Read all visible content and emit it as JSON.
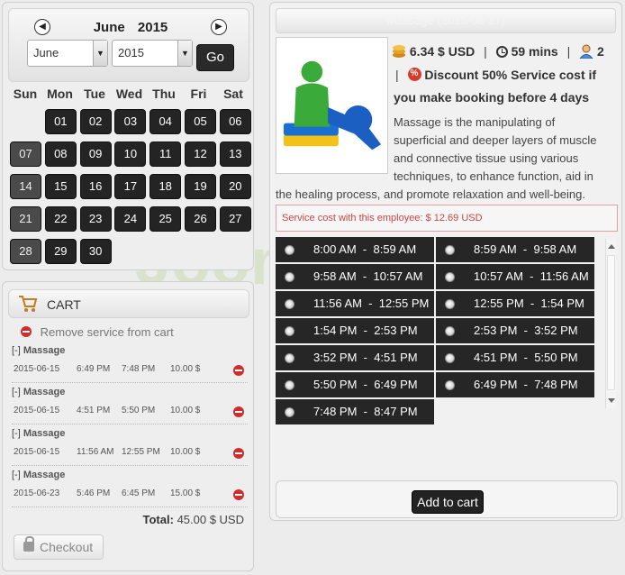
{
  "calendar": {
    "prev_icon": "chevron-left-icon",
    "next_icon": "chevron-right-icon",
    "month": "June",
    "year": "2015",
    "month_select": "June",
    "year_select": "2015",
    "go_label": "Go",
    "weekdays": [
      "Sun",
      "Mon",
      "Tue",
      "Wed",
      "Thu",
      "Fri",
      "Sat"
    ],
    "days": [
      {
        "d": "01",
        "col": 1,
        "row": 0,
        "state": "active"
      },
      {
        "d": "02",
        "col": 2,
        "row": 0,
        "state": "active"
      },
      {
        "d": "03",
        "col": 3,
        "row": 0,
        "state": "active"
      },
      {
        "d": "04",
        "col": 4,
        "row": 0,
        "state": "active"
      },
      {
        "d": "05",
        "col": 5,
        "row": 0,
        "state": "active"
      },
      {
        "d": "06",
        "col": 6,
        "row": 0,
        "state": "active"
      },
      {
        "d": "07",
        "col": 0,
        "row": 1,
        "state": "past"
      },
      {
        "d": "08",
        "col": 1,
        "row": 1,
        "state": "active"
      },
      {
        "d": "09",
        "col": 2,
        "row": 1,
        "state": "active"
      },
      {
        "d": "10",
        "col": 3,
        "row": 1,
        "state": "active"
      },
      {
        "d": "11",
        "col": 4,
        "row": 1,
        "state": "active"
      },
      {
        "d": "12",
        "col": 5,
        "row": 1,
        "state": "active"
      },
      {
        "d": "13",
        "col": 6,
        "row": 1,
        "state": "active"
      },
      {
        "d": "14",
        "col": 0,
        "row": 2,
        "state": "past"
      },
      {
        "d": "15",
        "col": 1,
        "row": 2,
        "state": "active"
      },
      {
        "d": "16",
        "col": 2,
        "row": 2,
        "state": "active"
      },
      {
        "d": "17",
        "col": 3,
        "row": 2,
        "state": "active"
      },
      {
        "d": "18",
        "col": 4,
        "row": 2,
        "state": "active"
      },
      {
        "d": "19",
        "col": 5,
        "row": 2,
        "state": "active"
      },
      {
        "d": "20",
        "col": 6,
        "row": 2,
        "state": "active"
      },
      {
        "d": "21",
        "col": 0,
        "row": 3,
        "state": "past"
      },
      {
        "d": "22",
        "col": 1,
        "row": 3,
        "state": "active"
      },
      {
        "d": "23",
        "col": 2,
        "row": 3,
        "state": "active"
      },
      {
        "d": "24",
        "col": 3,
        "row": 3,
        "state": "active"
      },
      {
        "d": "25",
        "col": 4,
        "row": 3,
        "state": "active"
      },
      {
        "d": "26",
        "col": 5,
        "row": 3,
        "state": "active"
      },
      {
        "d": "27",
        "col": 6,
        "row": 3,
        "state": "active"
      },
      {
        "d": "28",
        "col": 0,
        "row": 4,
        "state": "past"
      },
      {
        "d": "29",
        "col": 1,
        "row": 4,
        "state": "active"
      },
      {
        "d": "30",
        "col": 2,
        "row": 4,
        "state": "active"
      }
    ]
  },
  "cart": {
    "icon": "shopping-cart-icon",
    "title": "CART",
    "remove_label": "Remove service from cart",
    "items": [
      {
        "toggle": "[-]",
        "name": "Massage",
        "date": "2015-06-15",
        "start": "6:49 PM",
        "end": "7:48 PM",
        "price": "10.00 $"
      },
      {
        "toggle": "[-]",
        "name": "Massage",
        "date": "2015-06-15",
        "start": "4:51 PM",
        "end": "5:50 PM",
        "price": "10.00 $"
      },
      {
        "toggle": "[-]",
        "name": "Massage",
        "date": "2015-06-15",
        "start": "11:56 AM",
        "end": "12:55 PM",
        "price": "10.00 $"
      },
      {
        "toggle": "[-]",
        "name": "Massage",
        "date": "2015-06-23",
        "start": "5:46 PM",
        "end": "6:45 PM",
        "price": "15.00 $"
      }
    ],
    "total_label": "Total:",
    "total_value": "45.00 $ USD",
    "checkout_label": "Checkout"
  },
  "service": {
    "header": "Massage (2015-06-17)",
    "price": "6.34 $ USD",
    "duration": "59 mins",
    "capacity": "2",
    "discount": "Discount 50% Service cost if",
    "discount_2": "you make booking before 4 days",
    "description_lines": [
      "Massage is the manipulating of",
      "superficial and deeper layers of muscle",
      "and connective tissue using various",
      "techniques, to enhance function, aid in"
    ],
    "description_tail": "the healing process, and promote relaxation and well-being.",
    "cost_note": "Service cost with this employee: $ 12.69 USD",
    "slots": [
      {
        "label": "8:00 AM  -  8:59 AM"
      },
      {
        "label": "8:59 AM  -  9:58 AM"
      },
      {
        "label": "9:58 AM  -  10:57 AM"
      },
      {
        "label": "10:57 AM  -  11:56 AM"
      },
      {
        "label": "11:56 AM  -  12:55 PM"
      },
      {
        "label": "12:55 PM  -  1:54 PM"
      },
      {
        "label": "1:54 PM  -  2:53 PM"
      },
      {
        "label": "2:53 PM  -  3:52 PM"
      },
      {
        "label": "3:52 PM  -  4:51 PM"
      },
      {
        "label": "4:51 PM  -  5:50 PM"
      },
      {
        "label": "5:50 PM  -  6:49 PM"
      },
      {
        "label": "6:49 PM  -  7:48 PM"
      },
      {
        "label": "7:48 PM  -  8:47 PM"
      }
    ],
    "add_to_cart_label": "Add to cart"
  },
  "watermark": "Joomla bid"
}
